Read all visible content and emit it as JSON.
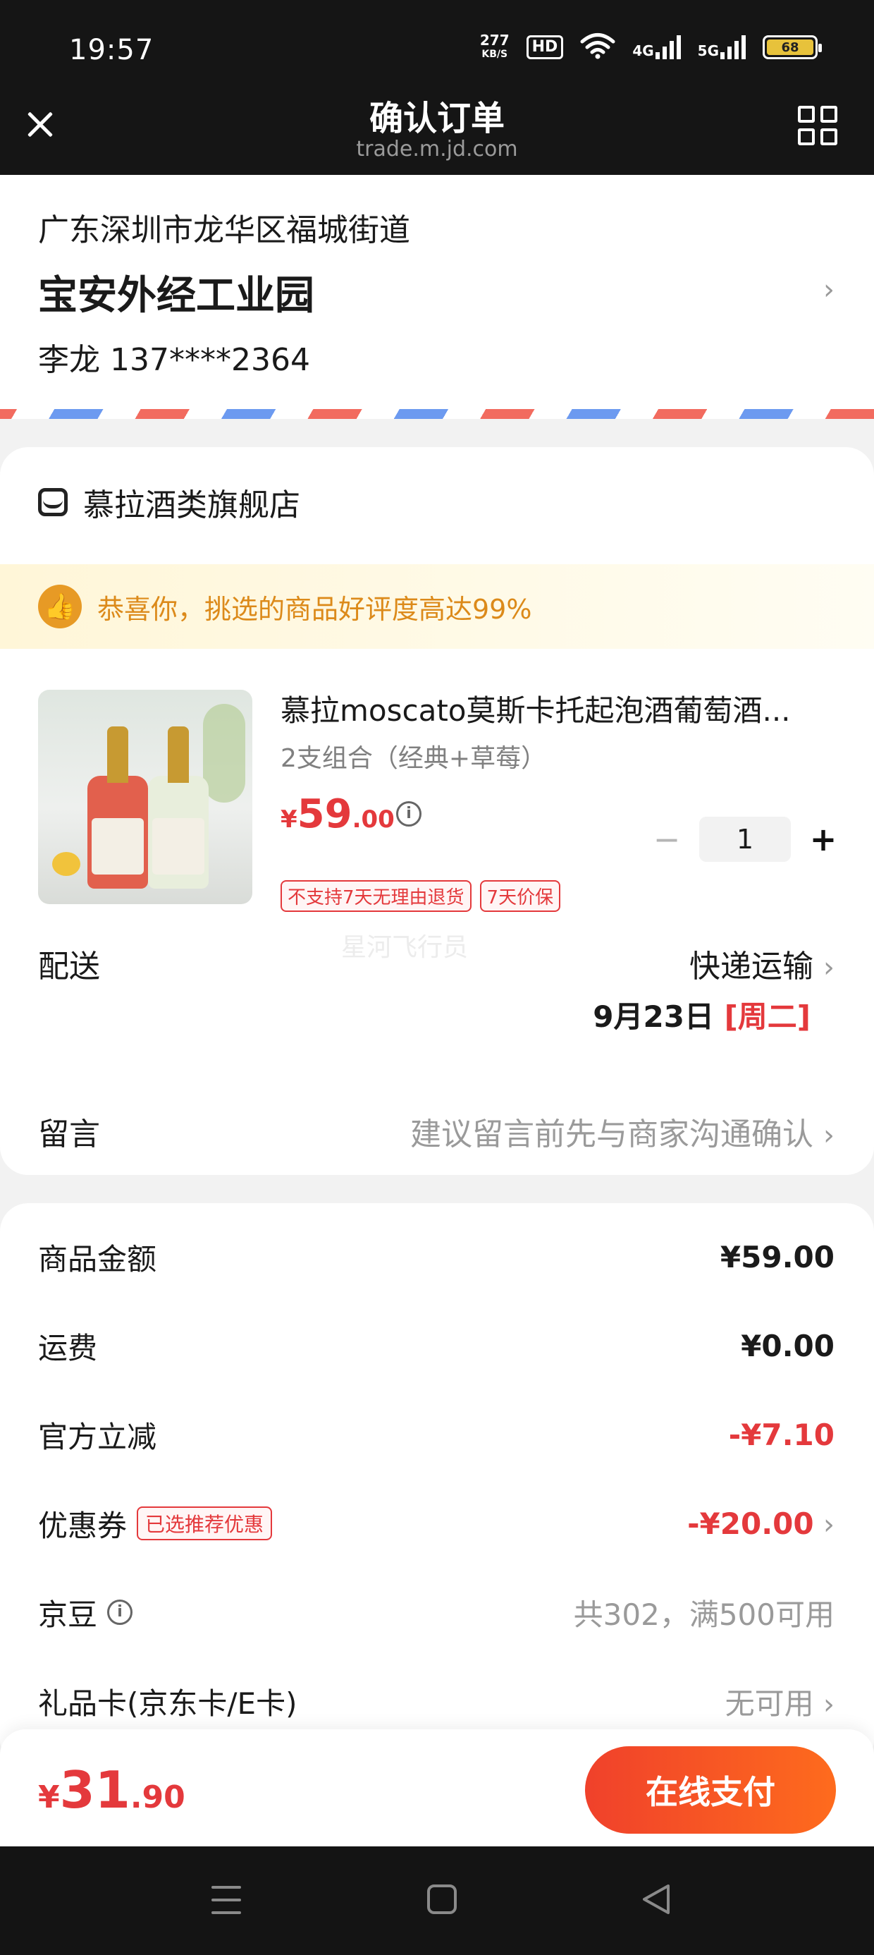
{
  "status_bar": {
    "time": "19:57",
    "net_speed": "277",
    "net_unit": "KB/S",
    "hd_label": "HD",
    "network_1": "4G",
    "network_2": "5G",
    "battery": "68"
  },
  "header": {
    "title": "确认订单",
    "url": "trade.m.jd.com"
  },
  "address": {
    "region": "广东深圳市龙华区福城街道",
    "detail": "宝安外经工业园",
    "contact": "李龙 137****2364",
    "chevron": "›"
  },
  "store": {
    "name": "慕拉酒类旗舰店",
    "praise": "恭喜你，挑选的商品好评度高达99%"
  },
  "product": {
    "title": "慕拉moscato莫斯卡托起泡酒葡萄酒...",
    "spec": "2支组合（经典+草莓）",
    "price_currency": "¥",
    "price_int": "59",
    "price_dec": ".00",
    "quantity": "1",
    "minus": "−",
    "plus": "+",
    "tags": [
      "不支持7天无理由退货",
      "7天价保"
    ]
  },
  "watermark": "星河飞行员",
  "delivery": {
    "label": "配送",
    "method": "快递运输",
    "date": "9月23日",
    "weekday": "[周二]"
  },
  "note": {
    "label": "留言",
    "hint": "建议留言前先与商家沟通确认"
  },
  "summary": {
    "items_label": "商品金额",
    "items_value": "¥59.00",
    "shipping_label": "运费",
    "shipping_value": "¥0.00",
    "discount_label": "官方立减",
    "discount_value": "-¥7.10",
    "coupon_label": "优惠券",
    "coupon_chip": "已选推荐优惠",
    "coupon_value": "-¥20.00",
    "jingdou_label": "京豆",
    "jingdou_value": "共302，满500可用",
    "giftcard_label": "礼品卡(京东卡/E卡)",
    "giftcard_value": "无可用"
  },
  "paybar": {
    "currency": "¥",
    "total_int": "31",
    "total_dec": ".90",
    "pay_label": "在线支付"
  },
  "colors": {
    "accent": "#e4393c",
    "pay_gradient_start": "#f0412b",
    "pay_gradient_end": "#fe6b1d",
    "praise_text": "#dc8a1a"
  }
}
